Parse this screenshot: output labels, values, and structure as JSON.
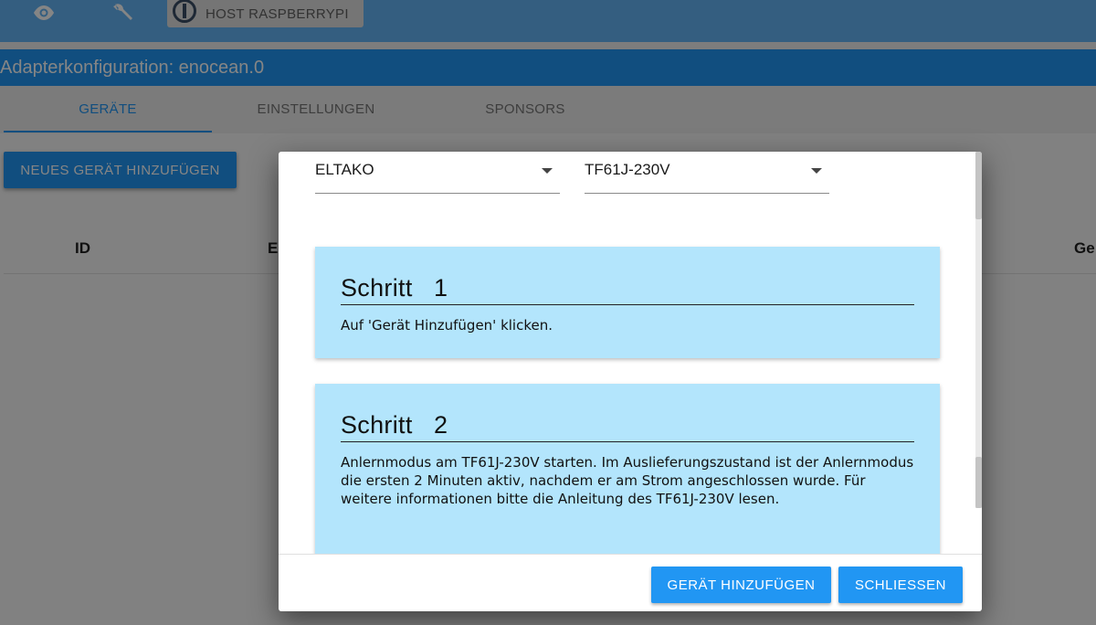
{
  "header": {
    "host_label": "HOST RASPBERRYPI"
  },
  "title": "Adapterkonfiguration: enocean.0",
  "tabs": [
    {
      "label": "GERÄTE",
      "active": true
    },
    {
      "label": "EINSTELLUNGEN",
      "active": false
    },
    {
      "label": "SPONSORS",
      "active": false
    }
  ],
  "main": {
    "add_device_label": "NEUES GERÄT HINZUFÜGEN",
    "table_headers": [
      "ID",
      "E",
      "Ge"
    ]
  },
  "dialog": {
    "manufacturer_select": "ELTAKO",
    "device_select": "TF61J-230V",
    "steps": [
      {
        "title": "Schritt   1",
        "text": "Auf 'Gerät Hinzufügen' klicken."
      },
      {
        "title": "Schritt   2",
        "text": "Anlernmodus am TF61J-230V starten. Im Auslieferungszustand ist der Anlernmodus die ersten 2 Minuten aktiv, nachdem er am Strom angeschlossen wurde. Für weitere informationen bitte die Anleitung des TF61J-230V lesen."
      }
    ],
    "buttons": {
      "add_label": "GERÄT HINZUFÜGEN",
      "close_label": "SCHLIESSEN"
    }
  },
  "colors": {
    "primary": "#2196f3",
    "topbar": "#64b5f6",
    "step_card": "#b3e5fc"
  }
}
